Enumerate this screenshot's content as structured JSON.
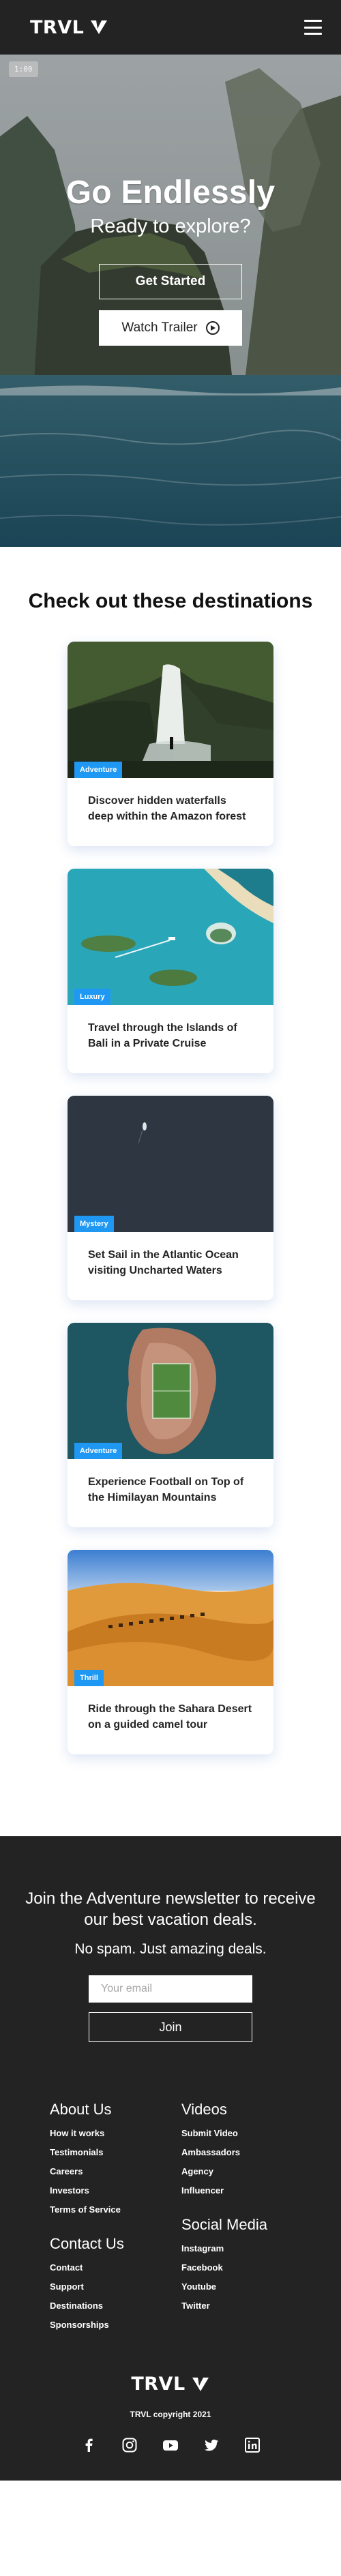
{
  "brand": {
    "name": "TRVL"
  },
  "nav": {
    "menu_icon": "hamburger-menu-icon"
  },
  "hero": {
    "video_time": "1:00",
    "title": "Go Endlessly",
    "subtitle": "Ready to explore?",
    "cta_primary": "Get Started",
    "cta_secondary": "Watch Trailer",
    "cta_secondary_icon": "play-circle-icon"
  },
  "destinations": {
    "title": "Check out these destinations",
    "cards": [
      {
        "tag": "Adventure",
        "text": "Discover hidden waterfalls deep within the Amazon forest"
      },
      {
        "tag": "Luxury",
        "text": "Travel through the Islands of Bali in a Private Cruise"
      },
      {
        "tag": "Mystery",
        "text": "Set Sail in the Atlantic Ocean visiting Uncharted Waters"
      },
      {
        "tag": "Adventure",
        "text": "Experience Football on Top of the Himilayan Mountains"
      },
      {
        "tag": "Thrill",
        "text": "Ride through the Sahara Desert on a guided camel tour"
      }
    ]
  },
  "newsletter": {
    "heading": "Join the Adventure newsletter to receive our best vacation deals.",
    "subheading": "No spam. Just amazing deals.",
    "email_placeholder": "Your email",
    "button": "Join"
  },
  "footer": {
    "columns": [
      {
        "title": "About Us",
        "links": [
          "How it works",
          "Testimonials",
          "Careers",
          "Investors",
          "Terms of Service"
        ]
      },
      {
        "title": "Videos",
        "links": [
          "Submit Video",
          "Ambassadors",
          "Agency",
          "Influencer"
        ]
      },
      {
        "title": "Contact Us",
        "links": [
          "Contact",
          "Support",
          "Destinations",
          "Sponsorships"
        ]
      },
      {
        "title": "Social Media",
        "links": [
          "Instagram",
          "Facebook",
          "Youtube",
          "Twitter"
        ]
      }
    ],
    "copyright": "TRVL copyright 2021",
    "social_icons": [
      "facebook-icon",
      "instagram-icon",
      "youtube-icon",
      "twitter-icon",
      "linkedin-icon"
    ]
  },
  "colors": {
    "dark_bg": "#232323",
    "tag_blue": "#1f98f4",
    "white": "#ffffff"
  }
}
